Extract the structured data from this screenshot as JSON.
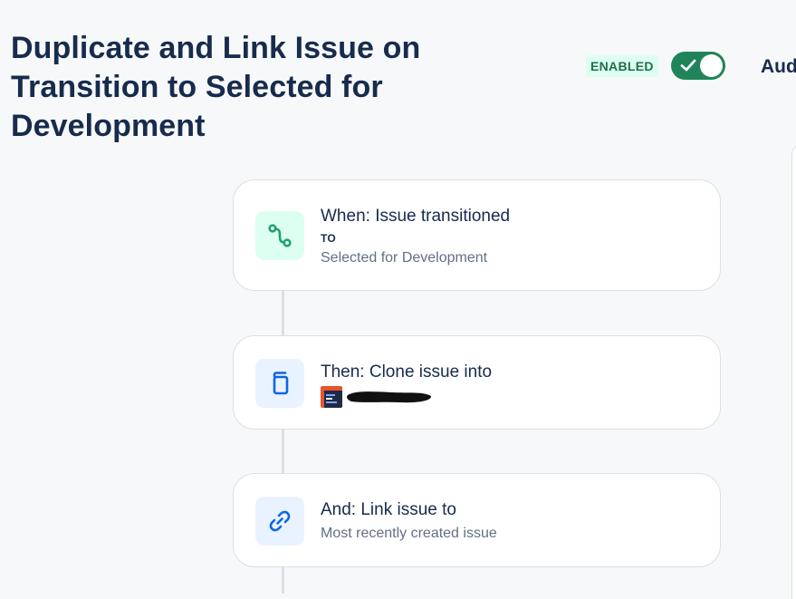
{
  "header": {
    "title": "Duplicate and Link Issue on Transition to Selected for Development",
    "status_badge": "ENABLED",
    "toggle_enabled": true,
    "audit_link": "Aud"
  },
  "rule": {
    "trigger": {
      "title": "When: Issue transitioned",
      "qualifier": "TO",
      "value": "Selected for Development",
      "icon": "transition-icon"
    },
    "action_clone": {
      "title": "Then: Clone issue into",
      "project_icon": "project-avatar-icon",
      "icon": "copy-icon"
    },
    "action_link": {
      "title": "And: Link issue to",
      "value": "Most recently created issue",
      "icon": "link-icon"
    }
  },
  "colors": {
    "toggle_on": "#1f845a",
    "badge_bg": "#dcfff1",
    "badge_text": "#216e4e",
    "trigger_icon": "#22a06b",
    "action_icon": "#0c66e4"
  }
}
